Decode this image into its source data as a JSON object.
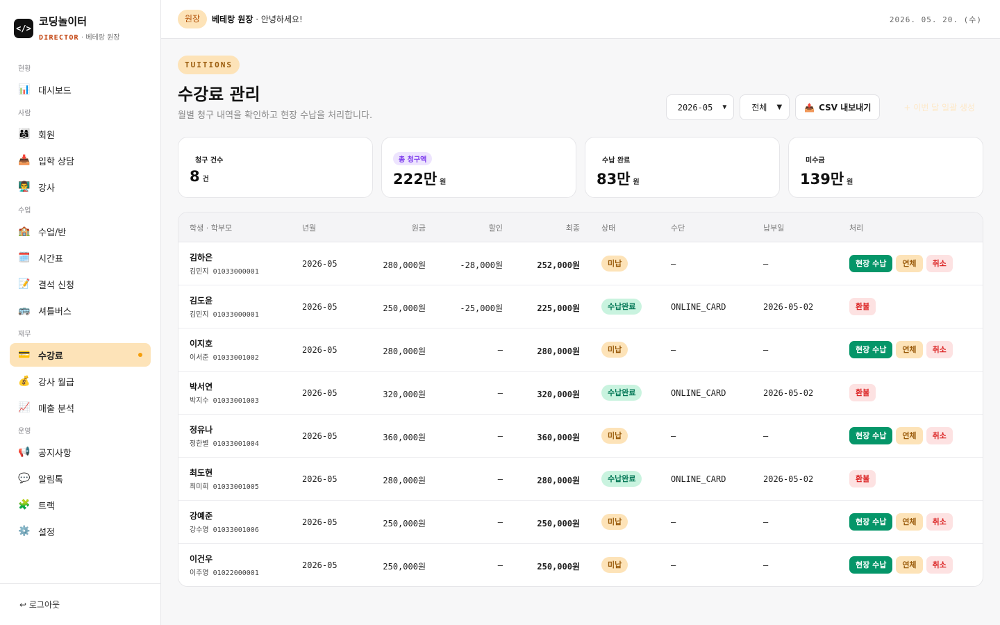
{
  "brand": {
    "logo": "</>",
    "name": "코딩놀이터",
    "role": "DIRECTOR",
    "sep": "·",
    "user": "베테랑 원장"
  },
  "nav": {
    "sections": [
      {
        "title": "현황",
        "items": [
          {
            "icon": "📊",
            "label": "대시보드"
          }
        ]
      },
      {
        "title": "사람",
        "items": [
          {
            "icon": "👨‍👩‍👧",
            "label": "회원"
          },
          {
            "icon": "📥",
            "label": "입학 상담"
          },
          {
            "icon": "👨‍🏫",
            "label": "강사"
          }
        ]
      },
      {
        "title": "수업",
        "items": [
          {
            "icon": "🏫",
            "label": "수업/반"
          },
          {
            "icon": "🗓️",
            "label": "시간표"
          },
          {
            "icon": "📝",
            "label": "결석 신청"
          },
          {
            "icon": "🚌",
            "label": "셔틀버스"
          }
        ]
      },
      {
        "title": "재무",
        "items": [
          {
            "icon": "💳",
            "label": "수강료",
            "active": true
          },
          {
            "icon": "💰",
            "label": "강사 월급"
          },
          {
            "icon": "📈",
            "label": "매출 분석"
          }
        ]
      },
      {
        "title": "운영",
        "items": [
          {
            "icon": "📢",
            "label": "공지사항"
          },
          {
            "icon": "💬",
            "label": "알림톡"
          },
          {
            "icon": "🧩",
            "label": "트랙"
          },
          {
            "icon": "⚙️",
            "label": "설정"
          }
        ]
      }
    ]
  },
  "logout": "↩ 로그아웃",
  "topbar": {
    "role_chip": "원장",
    "user": "베테랑 원장",
    "greeting": "· 안녕하세요!",
    "date": "2026. 05. 20. (수)"
  },
  "page": {
    "eyebrow": "TUITIONS",
    "title": "수강료 관리",
    "description": "월별 청구 내역을 확인하고 현장 수납을 처리합니다.",
    "month_select": "2026-05",
    "status_select": "전체",
    "csv_icon": "📤",
    "csv_button": "CSV 내보내기",
    "ghost_button": "+ 이번 달 일괄 생성"
  },
  "stats": [
    {
      "label": "청구 건수",
      "value": "8",
      "unit": "건",
      "pill": false
    },
    {
      "label": "총 청구액",
      "value": "222만",
      "unit": "원",
      "pill": true
    },
    {
      "label": "수납 완료",
      "value": "83만",
      "unit": "원",
      "pill": false
    },
    {
      "label": "미수금",
      "value": "139만",
      "unit": "원",
      "pill": false
    }
  ],
  "table": {
    "headers": {
      "student": "학생 · 학부모",
      "month": "년월",
      "base": "원금",
      "discount": "할인",
      "final": "최종",
      "status": "상태",
      "method": "수단",
      "paid_date": "납부일",
      "action": "처리"
    },
    "actions": {
      "collect": "현장 수납",
      "overdue": "연체",
      "cancel": "취소",
      "refund": "환불"
    },
    "rows": [
      {
        "student": "김하은",
        "parent": "김민지 01033000001",
        "month": "2026-05",
        "base": "280,000원",
        "discount": "-28,000원",
        "final": "252,000원",
        "status": "미납",
        "paid": false,
        "method": "—",
        "paid_date": "—"
      },
      {
        "student": "김도윤",
        "parent": "김민지 01033000001",
        "month": "2026-05",
        "base": "250,000원",
        "discount": "-25,000원",
        "final": "225,000원",
        "status": "수납완료",
        "paid": true,
        "method": "ONLINE_CARD",
        "paid_date": "2026-05-02"
      },
      {
        "student": "이지호",
        "parent": "이서준 01033001002",
        "month": "2026-05",
        "base": "280,000원",
        "discount": "—",
        "final": "280,000원",
        "status": "미납",
        "paid": false,
        "method": "—",
        "paid_date": "—"
      },
      {
        "student": "박서연",
        "parent": "박지수 01033001003",
        "month": "2026-05",
        "base": "320,000원",
        "discount": "—",
        "final": "320,000원",
        "status": "수납완료",
        "paid": true,
        "method": "ONLINE_CARD",
        "paid_date": "2026-05-02"
      },
      {
        "student": "정유나",
        "parent": "정한별 01033001004",
        "month": "2026-05",
        "base": "360,000원",
        "discount": "—",
        "final": "360,000원",
        "status": "미납",
        "paid": false,
        "method": "—",
        "paid_date": "—"
      },
      {
        "student": "최도현",
        "parent": "최미희 01033001005",
        "month": "2026-05",
        "base": "280,000원",
        "discount": "—",
        "final": "280,000원",
        "status": "수납완료",
        "paid": true,
        "method": "ONLINE_CARD",
        "paid_date": "2026-05-02"
      },
      {
        "student": "강예준",
        "parent": "강수영 01033001006",
        "month": "2026-05",
        "base": "250,000원",
        "discount": "—",
        "final": "250,000원",
        "status": "미납",
        "paid": false,
        "method": "—",
        "paid_date": "—"
      },
      {
        "student": "이건우",
        "parent": "이주영 01022000001",
        "month": "2026-05",
        "base": "250,000원",
        "discount": "—",
        "final": "250,000원",
        "status": "미납",
        "paid": false,
        "method": "—",
        "paid_date": "—"
      }
    ]
  },
  "colors": {
    "accent": "#fde3b8",
    "accent_text": "#b45309",
    "success": "#059669",
    "danger": "#dc2626",
    "purple": "#7c3aed"
  }
}
